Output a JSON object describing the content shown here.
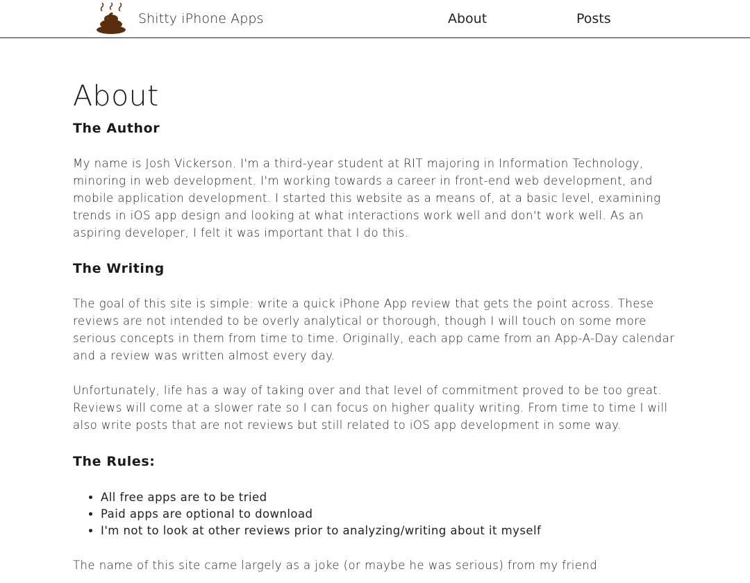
{
  "header": {
    "site_name": "Shitty iPhone Apps",
    "logo_icon": "poop-emoji-icon",
    "nav": [
      "About",
      "Posts"
    ]
  },
  "page": {
    "title": "About",
    "sections": [
      {
        "heading": "The Author",
        "paragraphs": [
          "My name is Josh Vickerson. I'm a third-year student at RIT majoring in Information Technology, minoring in web development. I'm working towards a career in front-end web development, and mobile application development. I started this website as a means of, at a basic level, examining trends in iOS app design and looking at what interactions work well and don't work well. As an aspiring developer, I felt it was important that I do this."
        ]
      },
      {
        "heading": "The Writing",
        "paragraphs": [
          "The goal of this site is simple: write a quick iPhone App review that gets the point across. These reviews are not intended to be overly analytical or thorough, though I will touch on some more serious concepts in them from time to time. Originally, each app came from an App-A-Day calendar and a review was written almost every day.",
          "Unfortunately, life has a way of taking over and that level of commitment proved to be too great. Reviews will come at a slower rate so I can focus on higher quality writing. From time to time I will also write posts that are not reviews but still related to iOS app development in some way."
        ]
      },
      {
        "heading": "The Rules:",
        "rules": [
          "All free apps are to be tried",
          "Paid apps are optional to download",
          "I'm not to look at other reviews prior to analyzing/writing about it myself"
        ]
      }
    ],
    "closing": "The name of this site came largely as a joke (or maybe he was serious) from my friend"
  },
  "colors": {
    "logo_brown": "#5a2d0c",
    "steam_brown": "#6b3a16",
    "text": "#222222"
  }
}
